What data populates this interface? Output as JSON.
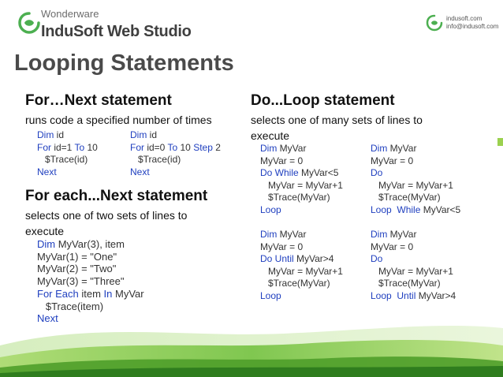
{
  "header": {
    "brand_top": "Wonderware",
    "brand_main": "InduSoft Web Studio",
    "contact_web": "indusoft.com",
    "contact_mail": "info@indusoft.com"
  },
  "title": "Looping Statements",
  "for_next": {
    "heading": "For…Next statement",
    "description": "runs code a specified number of times",
    "code_a": [
      [
        {
          "t": "Dim",
          "k": true
        },
        {
          "t": " id"
        }
      ],
      [
        {
          "t": "For",
          "k": true
        },
        {
          "t": " id=1 "
        },
        {
          "t": "To",
          "k": true
        },
        {
          "t": " 10"
        }
      ],
      [
        {
          "t": "   $Trace(id)"
        }
      ],
      [
        {
          "t": "Next",
          "k": true
        }
      ]
    ],
    "code_b": [
      [
        {
          "t": "Dim",
          "k": true
        },
        {
          "t": " id"
        }
      ],
      [
        {
          "t": "For",
          "k": true
        },
        {
          "t": " id=0 "
        },
        {
          "t": "To",
          "k": true
        },
        {
          "t": " 10 "
        },
        {
          "t": "Step",
          "k": true
        },
        {
          "t": " 2"
        }
      ],
      [
        {
          "t": "   $Trace(id)"
        }
      ],
      [
        {
          "t": "Next",
          "k": true
        }
      ]
    ]
  },
  "for_each": {
    "heading": "For each...Next statement",
    "description": "selects one of two sets of lines to execute",
    "code": [
      [
        {
          "t": "Dim",
          "k": true
        },
        {
          "t": " MyVar(3), item"
        }
      ],
      [
        {
          "t": "MyVar(1) = \"One\""
        }
      ],
      [
        {
          "t": "MyVar(2) = \"Two\""
        }
      ],
      [
        {
          "t": "MyVar(3) = \"Three\""
        }
      ],
      [
        {
          "t": "For Each",
          "k": true
        },
        {
          "t": " item "
        },
        {
          "t": "In",
          "k": true
        },
        {
          "t": " MyVar"
        }
      ],
      [
        {
          "t": "   $Trace(item)"
        }
      ],
      [
        {
          "t": "Next",
          "k": true
        }
      ]
    ]
  },
  "do_loop": {
    "heading": "Do...Loop statement",
    "description": "selects one of many sets of lines to execute",
    "code_1": [
      [
        {
          "t": "Dim",
          "k": true
        },
        {
          "t": " MyVar"
        }
      ],
      [
        {
          "t": "MyVar = 0"
        }
      ],
      [
        {
          "t": "Do While",
          "k": true
        },
        {
          "t": " MyVar<5"
        }
      ],
      [
        {
          "t": "   MyVar = MyVar+1"
        }
      ],
      [
        {
          "t": "   $Trace(MyVar)"
        }
      ],
      [
        {
          "t": "Loop",
          "k": true
        }
      ]
    ],
    "code_2": [
      [
        {
          "t": "Dim",
          "k": true
        },
        {
          "t": " MyVar"
        }
      ],
      [
        {
          "t": "MyVar = 0"
        }
      ],
      [
        {
          "t": "Do",
          "k": true
        }
      ],
      [
        {
          "t": "   MyVar = MyVar+1"
        }
      ],
      [
        {
          "t": "   $Trace(MyVar)"
        }
      ],
      [
        {
          "t": "Loop  While",
          "k": true
        },
        {
          "t": " MyVar<5"
        }
      ]
    ],
    "code_3": [
      [
        {
          "t": "Dim",
          "k": true
        },
        {
          "t": " MyVar"
        }
      ],
      [
        {
          "t": "MyVar = 0"
        }
      ],
      [
        {
          "t": "Do Until",
          "k": true
        },
        {
          "t": " MyVar>4"
        }
      ],
      [
        {
          "t": "   MyVar = MyVar+1"
        }
      ],
      [
        {
          "t": "   $Trace(MyVar)"
        }
      ],
      [
        {
          "t": "Loop",
          "k": true
        }
      ]
    ],
    "code_4": [
      [
        {
          "t": "Dim",
          "k": true
        },
        {
          "t": " MyVar"
        }
      ],
      [
        {
          "t": "MyVar = 0"
        }
      ],
      [
        {
          "t": "Do",
          "k": true
        }
      ],
      [
        {
          "t": "   MyVar = MyVar+1"
        }
      ],
      [
        {
          "t": "   $Trace(MyVar)"
        }
      ],
      [
        {
          "t": "Loop  Until",
          "k": true
        },
        {
          "t": " MyVar>4"
        }
      ]
    ]
  },
  "colors": {
    "keyword": "#1f3fbf",
    "brand_green": "#4caf50",
    "wave_green": "#7ac143"
  },
  "icons": [
    "indusoft-logo-icon",
    "contact-logo-icon"
  ]
}
